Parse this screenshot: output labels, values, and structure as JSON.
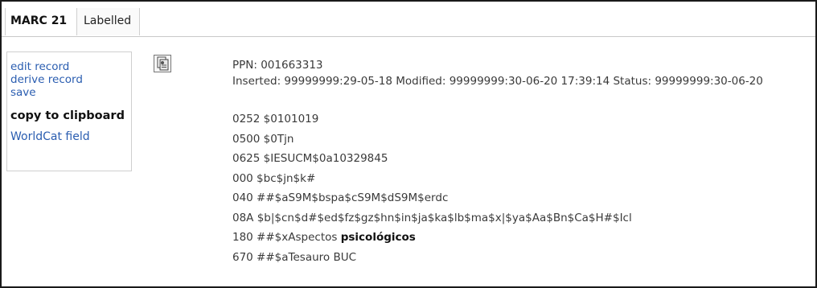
{
  "tabs": [
    {
      "label": "MARC 21"
    },
    {
      "label": "Labelled"
    }
  ],
  "actions": {
    "edit": "edit record",
    "derive": "derive record",
    "save": "save",
    "copy": "copy to clipboard",
    "worldcat": "WorldCat field"
  },
  "toolbar": {
    "icon": "copy-record-icon"
  },
  "record": {
    "ppn": "PPN: 001663313",
    "dates": "Inserted: 99999999:29-05-18 Modified: 99999999:30-06-20 17:39:14 Status: 99999999:30-06-20",
    "fields": [
      "0252 $0101019",
      "0500 $0Tjn",
      "0625 $IESUCM$0a10329845",
      "000 $bc$jn$k#",
      "040 ##$aS9M$bspa$cS9M$dS9M$erdc",
      "08A $b|$cn$d#$ed$fz$gz$hn$in$ja$ka$lb$ma$x|$ya$Aa$Bn$Ca$H#$Icl"
    ],
    "field180_prefix": "180 ##$xAspectos ",
    "field180_bold": "psicológicos",
    "field670": "670 ##$aTesauro BUC"
  }
}
